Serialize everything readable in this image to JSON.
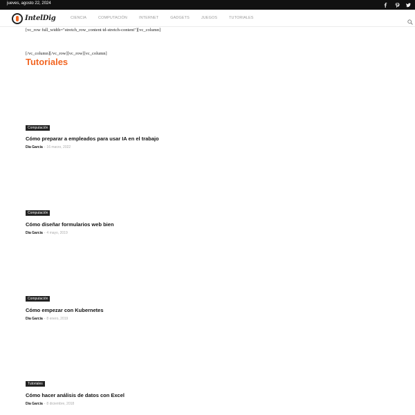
{
  "topbar": {
    "date": "jueves, agosto 22, 2024",
    "social": [
      "facebook-icon",
      "pinterest-icon",
      "twitter-icon"
    ]
  },
  "header": {
    "logo_text": "IntelDig",
    "nav": [
      "CIENCIA",
      "COMPUTACIÓN",
      "INTERNET",
      "GADGETS",
      "JUEGOS",
      "TUTORIALES"
    ],
    "search_icon": "search-icon"
  },
  "shortcodes": {
    "row_open": "[vc_row full_width=\"stretch_row_content td-stretch-content\"][vc_column]",
    "row_close": "[/vc_column][/vc_row][vc_row][vc_column]"
  },
  "section": {
    "title": "Tutoriales"
  },
  "posts": [
    {
      "category": "Computación",
      "title": "Cómo preparar a empleados para usar IA en el trabajo",
      "author": "Día García",
      "separator": "-",
      "date": "16 marzo, 2022"
    },
    {
      "category": "Computación",
      "title": "Cómo diseñar formularios web bien",
      "author": "Día García",
      "separator": "-",
      "date": "4 mayo, 2019"
    },
    {
      "category": "Computación",
      "title": "Cómo empezar con Kubernetes",
      "author": "Día García",
      "separator": "-",
      "date": "8 enero, 2019"
    },
    {
      "category": "Tutoriales",
      "title": "Cómo hacer análisis de datos con Excel",
      "author": "Día García",
      "separator": "-",
      "date": "8 diciembre, 2018"
    }
  ],
  "colors": {
    "accent": "#f26522",
    "topbar": "#111111",
    "category_badge": "#222222"
  }
}
